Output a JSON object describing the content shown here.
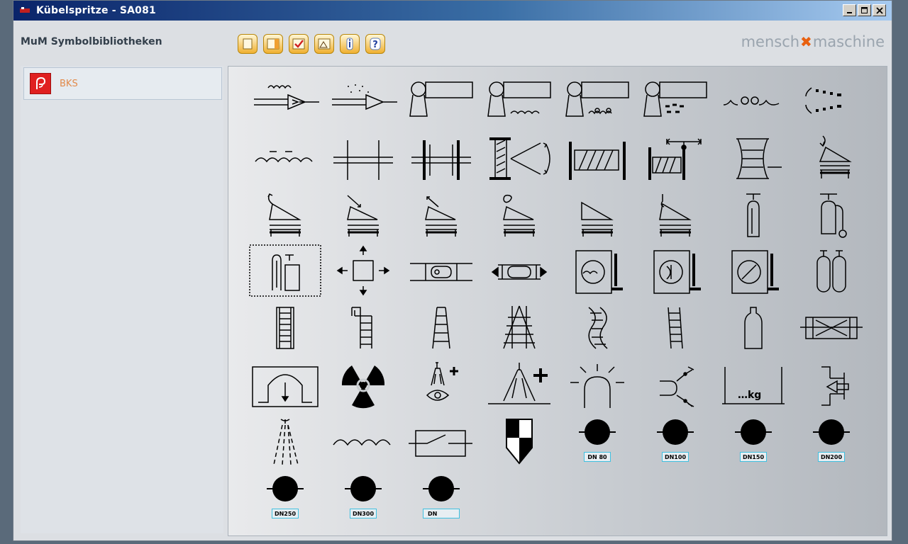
{
  "window": {
    "title": "Kübelspritze  -  SA081"
  },
  "toolbar": {
    "library_title": "MuM Symbolbibliotheken"
  },
  "logo": {
    "left": "mensch",
    "right": "maschine"
  },
  "sidebar": {
    "items": [
      {
        "label": "BKS"
      }
    ]
  },
  "symbols": {
    "dn_labels": [
      "DN 80",
      "DN100",
      "DN150",
      "DN200",
      "DN250",
      "DN300",
      "DN"
    ]
  }
}
